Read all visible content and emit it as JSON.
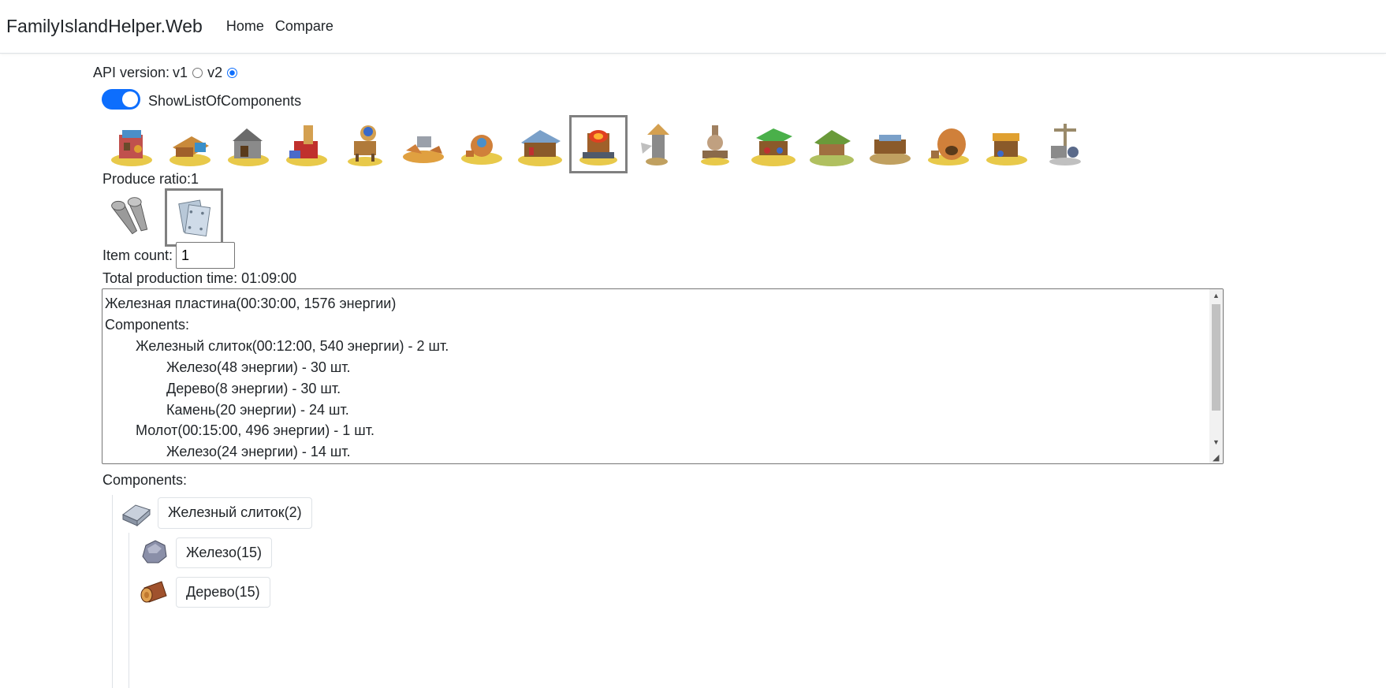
{
  "navbar": {
    "brand": "FamilyIslandHelper.Web",
    "links": [
      "Home",
      "Compare"
    ]
  },
  "api": {
    "label": "API version:",
    "options": [
      "v1",
      "v2"
    ],
    "selected": "v2"
  },
  "toggle": {
    "label": "ShowListOfComponents",
    "on": true
  },
  "buildings": {
    "count": 17,
    "selected_index": 8
  },
  "produce_ratio": "Produce ratio:1",
  "items": {
    "icons": [
      "nails-icon",
      "iron-plate-icon"
    ],
    "selected_index": 1
  },
  "item_count": {
    "label": "Item count:",
    "value": "1"
  },
  "total_time": "Total production time: 01:09:00",
  "details": {
    "lines": [
      "Железная пластина(00:30:00, 1576 энергии)",
      "Components:",
      "Железный слиток(00:12:00, 540 энергии) - 2 шт.",
      "Железо(48 энергии) - 30 шт.",
      "Дерево(8 энергии) - 30 шт.",
      "Камень(20 энергии) - 24 шт.",
      "Молот(00:15:00, 496 энергии) - 1 шт.",
      "Железо(24 энергии) - 14 шт."
    ]
  },
  "components": {
    "title": "Components:",
    "nodes": [
      {
        "label": "Железный слиток(2)",
        "icon": "iron-ingot-icon"
      },
      {
        "label": "Железо(15)",
        "icon": "iron-ore-icon"
      },
      {
        "label": "Дерево(15)",
        "icon": "wood-log-icon"
      }
    ]
  },
  "colors": {
    "accent": "#0d6efd",
    "selected_border": "#808080"
  }
}
